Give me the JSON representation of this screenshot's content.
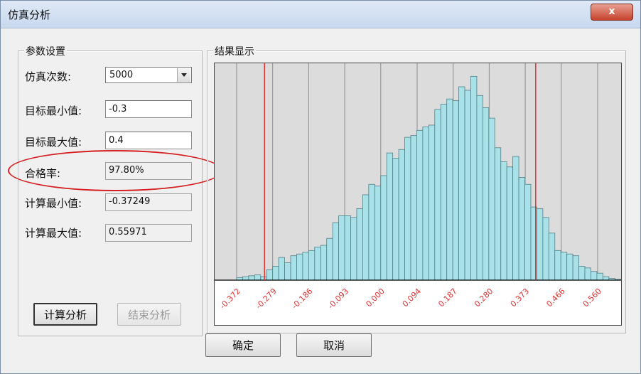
{
  "window": {
    "title": "仿真分析",
    "close_label": "x"
  },
  "params": {
    "group_title": "参数设置",
    "sim_count_label": "仿真次数:",
    "sim_count_value": "5000",
    "target_min_label": "目标最小值:",
    "target_min_value": "-0.3",
    "target_max_label": "目标最大值:",
    "target_max_value": "0.4",
    "pass_rate_label": "合格率:",
    "pass_rate_value": "97.80%",
    "calc_min_label": "计算最小值:",
    "calc_min_value": "-0.37249",
    "calc_max_label": "计算最大值:",
    "calc_max_value": "0.55971",
    "calc_button": "计算分析",
    "end_button": "结束分析"
  },
  "result": {
    "group_title": "结果显示"
  },
  "footer": {
    "ok_button": "确定",
    "cancel_button": "取消"
  },
  "colors": {
    "bar_fill": "#a9e1e8",
    "bar_stroke": "#4f7f86",
    "limit_line": "#e03030",
    "tick_label": "#e03030",
    "plot_bg": "#dcdcdc",
    "grid": "#8c8c8c",
    "annotation": "#d42020"
  },
  "chart_data": {
    "type": "bar",
    "title": "",
    "xlabel": "",
    "ylabel": "",
    "x_ticks": [
      "-0.372",
      "-0.279",
      "-0.186",
      "-0.093",
      "0.000",
      "0.094",
      "0.187",
      "0.280",
      "0.373",
      "0.466",
      "0.560"
    ],
    "xlim": [
      -0.372,
      0.56
    ],
    "bin_edges_start": -0.372,
    "bin_width": 0.0155,
    "values": [
      3,
      4,
      5,
      6,
      4,
      12,
      16,
      26,
      20,
      28,
      30,
      32,
      34,
      38,
      40,
      48,
      66,
      74,
      74,
      72,
      82,
      98,
      110,
      108,
      120,
      146,
      140,
      150,
      164,
      166,
      172,
      176,
      178,
      196,
      202,
      208,
      206,
      222,
      218,
      234,
      212,
      198,
      186,
      152,
      136,
      130,
      142,
      118,
      110,
      84,
      82,
      72,
      54,
      34,
      32,
      30,
      28,
      16,
      14,
      10,
      8,
      4,
      2,
      1,
      0,
      0,
      0,
      0
    ],
    "ymax": 240,
    "limit_lines": [
      -0.3,
      0.4
    ],
    "grid": true
  }
}
